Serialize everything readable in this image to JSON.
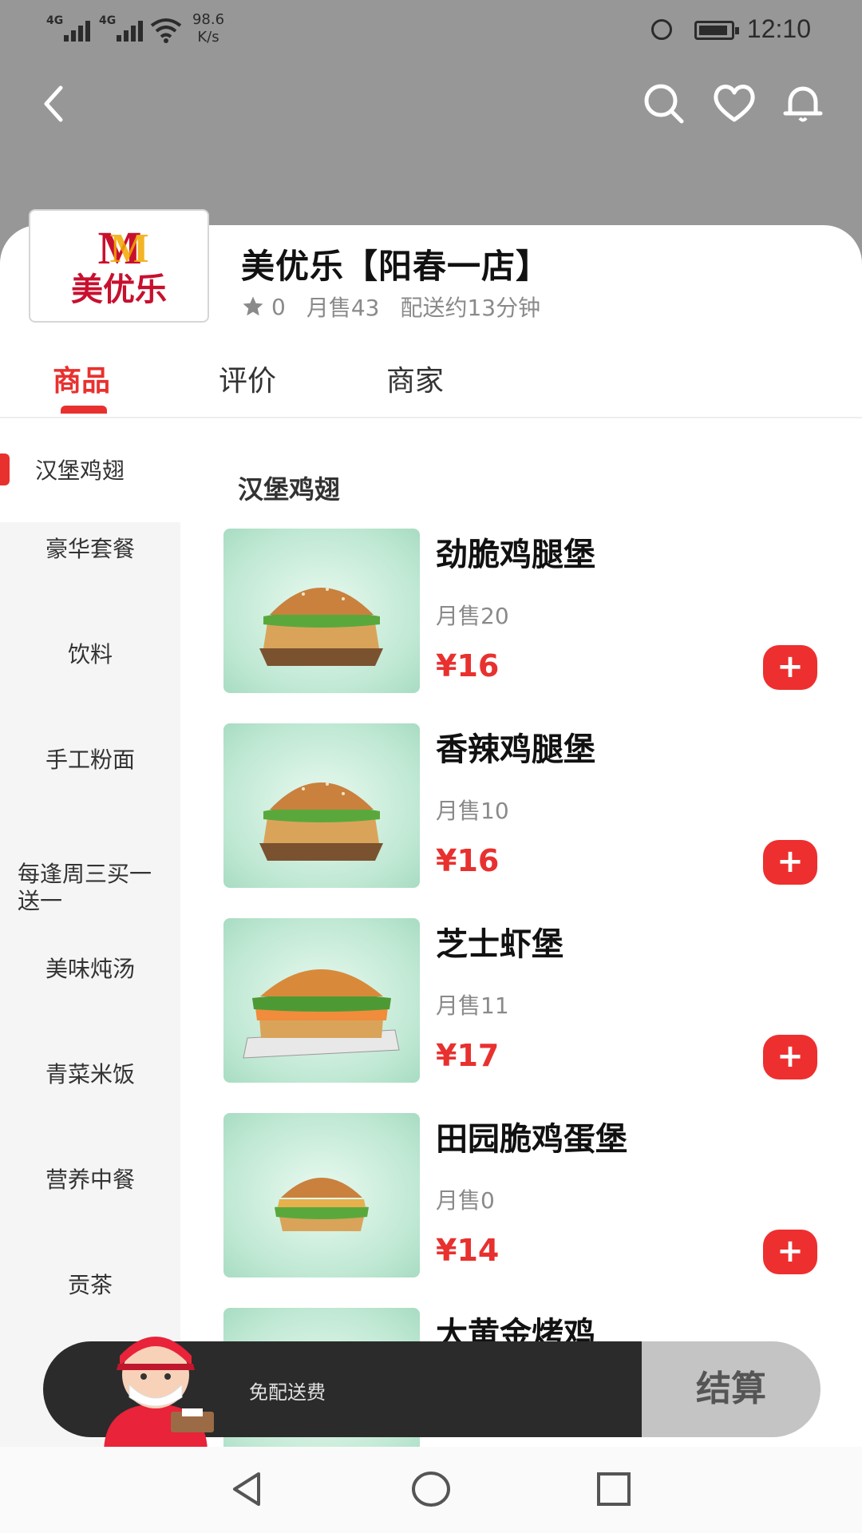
{
  "status_bar": {
    "sig1": "4G",
    "sig2": "4G",
    "net_speed_value": "98.6",
    "net_speed_unit": "K/s",
    "time": "12:10"
  },
  "header": {
    "icons": [
      "back-icon",
      "search-icon",
      "heart-icon",
      "bell-icon"
    ]
  },
  "shop": {
    "logo_text": "美优乐",
    "name": "美优乐【阳春一店】",
    "rating": "0",
    "monthly_sales": "月售43",
    "delivery_time": "配送约13分钟"
  },
  "tabs": [
    {
      "label": "商品",
      "active": true
    },
    {
      "label": "评价",
      "active": false
    },
    {
      "label": "商家",
      "active": false
    }
  ],
  "categories": [
    {
      "label": "汉堡鸡翅",
      "active": true
    },
    {
      "label": "豪华套餐"
    },
    {
      "label": "饮料"
    },
    {
      "label": "手工粉面"
    },
    {
      "label": "每逢周三买一送一"
    },
    {
      "label": "美味炖汤"
    },
    {
      "label": "青菜米饭"
    },
    {
      "label": "营养中餐"
    },
    {
      "label": "贡茶"
    }
  ],
  "section_title": "汉堡鸡翅",
  "products": [
    {
      "name": "劲脆鸡腿堡",
      "sold": "月售20",
      "price": "¥16"
    },
    {
      "name": "香辣鸡腿堡",
      "sold": "月售10",
      "price": "¥16"
    },
    {
      "name": "芝士虾堡",
      "sold": "月售11",
      "price": "¥17"
    },
    {
      "name": "田园脆鸡蛋堡",
      "sold": "月售0",
      "price": "¥14"
    },
    {
      "name": "大黄金烤鸡",
      "sold": "",
      "price": ""
    }
  ],
  "add_label": "+",
  "cart": {
    "delivery_text": "免配送费",
    "checkout_label": "结算"
  },
  "colors": {
    "accent": "#e8312f",
    "header_gray": "#979797",
    "cart_dark": "#2b2b2b"
  }
}
